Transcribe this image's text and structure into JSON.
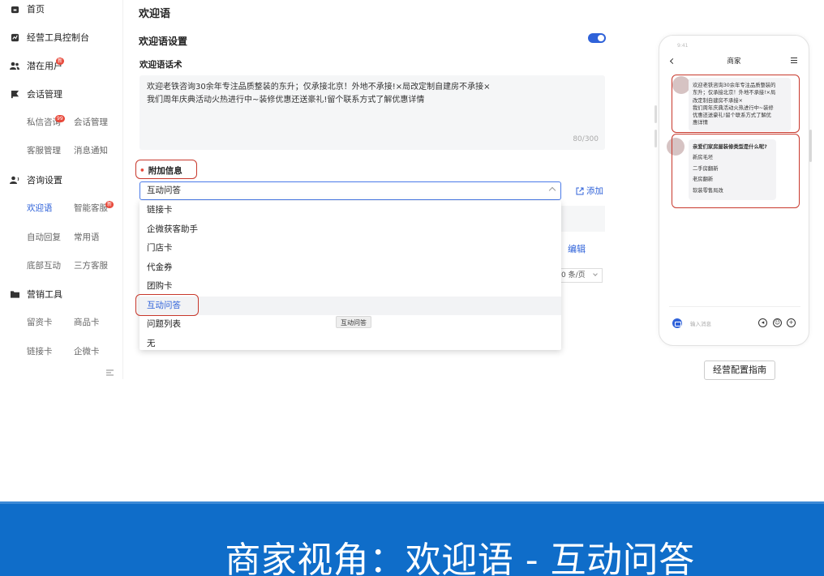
{
  "sidebar": {
    "main_items": [
      {
        "label": "首页",
        "icon": "home-icon"
      },
      {
        "label": "经营工具控制台",
        "icon": "dashboard-icon"
      },
      {
        "label": "潜在用户",
        "icon": "users-icon",
        "badge": "新"
      },
      {
        "label": "会话管理",
        "icon": "flag-icon"
      },
      {
        "label": "咨询设置",
        "icon": "user-settings-icon"
      },
      {
        "label": "营销工具",
        "icon": "folder-icon"
      }
    ],
    "sub_items": {
      "session": [
        "私信咨询",
        "会话管理",
        "客服管理",
        "消息通知"
      ],
      "session_badge": "99",
      "consult": [
        "欢迎语",
        "智能客服",
        "自动回复",
        "常用语",
        "底部互动",
        "三方客服"
      ],
      "consult_badge": "新",
      "marketing": [
        "留资卡",
        "商品卡",
        "链接卡",
        "企微卡"
      ]
    }
  },
  "main": {
    "page_title": "欢迎语",
    "section_title": "欢迎语设置",
    "toggle_on": true,
    "script_label": "欢迎语话术",
    "script_line1": "欢迎老铁咨询30余年专注品质整装的东升；仅承接北京！外地不承接!×局改定制自建房不承接×",
    "script_line2": "我们周年庆典活动火热进行中~装修优惠还送豪礼!留个联系方式了解优惠详情",
    "counter": "80/300",
    "extra_label": "附加信息",
    "required_mark": "•",
    "select_value": "互动问答",
    "add_label": "添加",
    "edit_label": "编辑",
    "pager_label": "0 条/页"
  },
  "dropdown": {
    "options": [
      "链接卡",
      "企微获客助手",
      "门店卡",
      "代金券",
      "团购卡",
      "互动问答",
      "问题列表",
      "无"
    ],
    "selected": "互动问答",
    "tooltip": "互动问答"
  },
  "phone": {
    "status": "9:41",
    "title": "商家",
    "welcome_lines": [
      "欢迎老铁咨询30余年专注品质整装的",
      "东升；仅承接北京！外地不承接!×局",
      "改定制自建房不承接×",
      "我们周年庆典活动火热进行中~装修",
      "优惠还送豪礼!留个联系方式了解优",
      "惠详情"
    ],
    "question": "亲爱们家房屋装修类型是什么呢?",
    "answers": [
      "新房毛坯",
      "二手房翻新",
      "老房翻新",
      "软装零售局改"
    ],
    "input_placeholder": "输入消息"
  },
  "guide_button": "经营配置指南",
  "banner": "商家视角：欢迎语 - 互动问答",
  "colors": {
    "accent": "#2f62d9",
    "highlight": "#c8382c",
    "banner": "#0f6dc9"
  }
}
